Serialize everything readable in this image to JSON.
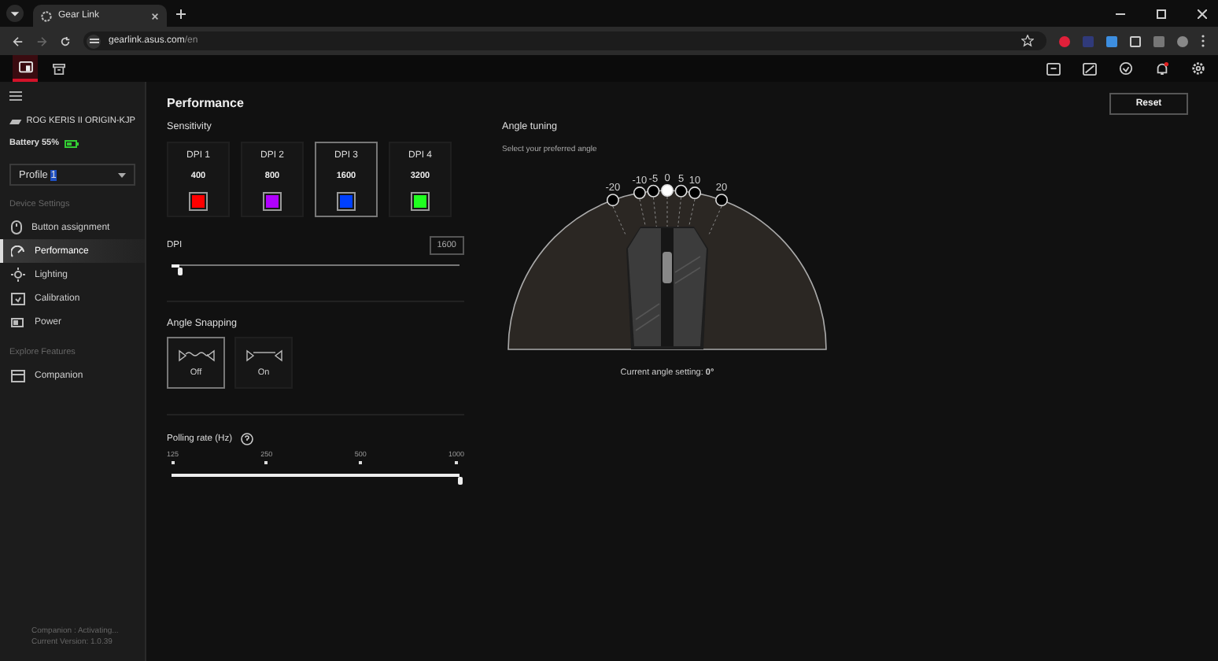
{
  "browser": {
    "tab_title": "Gear Link",
    "url_host": "gearlink.asus.com",
    "url_path": "/en"
  },
  "app_tabs": [
    {
      "kind": "device",
      "selected": true
    },
    {
      "kind": "store",
      "selected": false
    }
  ],
  "sidebar": {
    "device_name": "ROG KERIS II ORIGIN-KJP",
    "battery": "Battery 55%",
    "profile_prefix": "Profile ",
    "profile_number": "1",
    "sections": [
      {
        "title": "Device Settings",
        "items": [
          {
            "label": "Button assignment",
            "kind": "mouse",
            "selected": false
          },
          {
            "label": "Performance",
            "kind": "gauge",
            "selected": true
          },
          {
            "label": "Lighting",
            "kind": "light",
            "selected": false
          },
          {
            "label": "Calibration",
            "kind": "calibrate",
            "selected": false
          },
          {
            "label": "Power",
            "kind": "battery",
            "selected": false
          }
        ]
      },
      {
        "title": "Explore Features",
        "items": [
          {
            "label": "Companion",
            "kind": "window",
            "selected": false
          }
        ]
      }
    ],
    "footer": [
      "Companion : Activating...",
      "Current Version: 1.0.39"
    ]
  },
  "page": {
    "title": "Performance",
    "reset": "Reset",
    "sensitivity": {
      "title": "Sensitivity",
      "stages": [
        {
          "label": "DPI 1",
          "value": "400",
          "color": "#ff0000",
          "selected": false
        },
        {
          "label": "DPI 2",
          "value": "800",
          "color": "#b000ff",
          "selected": false
        },
        {
          "label": "DPI 3",
          "value": "1600",
          "color": "#0040ff",
          "selected": true
        },
        {
          "label": "DPI 4",
          "value": "3200",
          "color": "#20ff20",
          "selected": false
        }
      ]
    },
    "dpi": {
      "label": "DPI",
      "value": "1600",
      "level": 0.03
    },
    "angle_snapping": {
      "title": "Angle Snapping",
      "options": [
        {
          "label": "Off",
          "kind": "wavy",
          "selected": true
        },
        {
          "label": "On",
          "kind": "straight",
          "selected": false
        }
      ]
    },
    "polling": {
      "label": "Polling rate (Hz)",
      "ticks": [
        "125",
        "250",
        "500",
        "1000"
      ],
      "level": 1
    },
    "angle_tuning": {
      "title": "Angle tuning",
      "subtitle": "Select your preferred angle",
      "angles": [
        {
          "label": "-20",
          "selected": false
        },
        {
          "label": "-10",
          "selected": false
        },
        {
          "label": "-5",
          "selected": false
        },
        {
          "label": "0",
          "selected": true
        },
        {
          "label": "5",
          "selected": false
        },
        {
          "label": "10",
          "selected": false
        },
        {
          "label": "20",
          "selected": false
        }
      ],
      "current": "Current angle setting: **0°**"
    }
  }
}
